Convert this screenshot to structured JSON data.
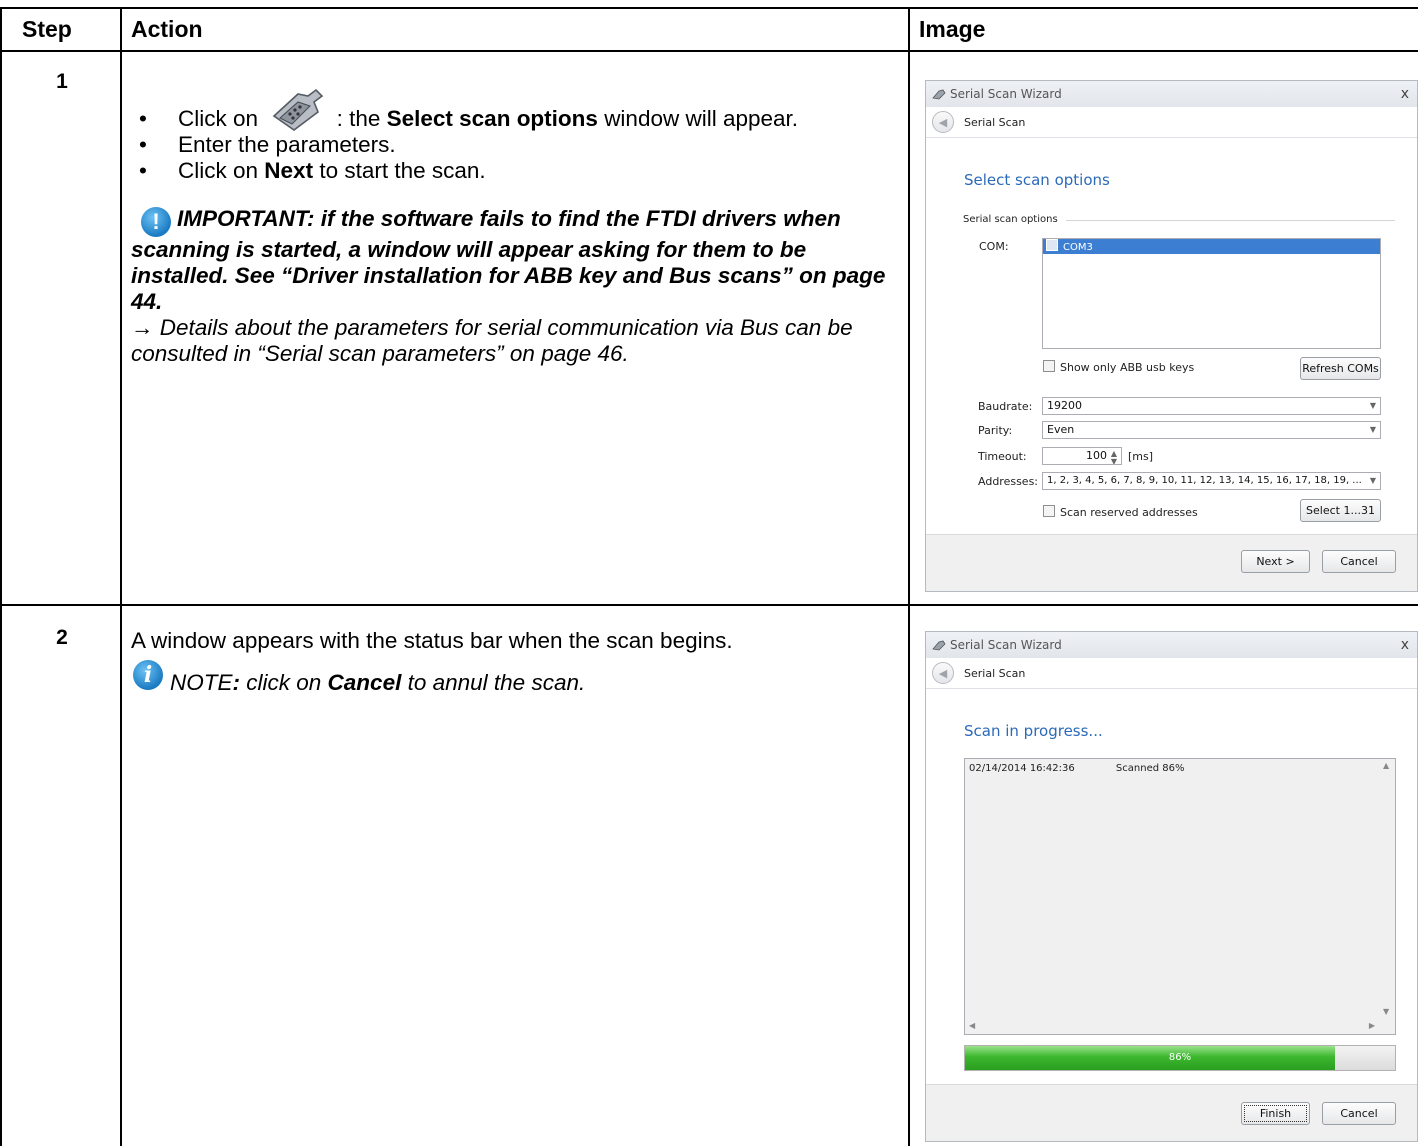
{
  "table": {
    "headers": {
      "step": "Step",
      "action": "Action",
      "image": "Image"
    },
    "rows": [
      {
        "step": "1",
        "bullets": {
          "b1_prefix": "Click on",
          "b1_bold": "Select scan options",
          "b1_suffix_pre": ": the",
          "b1_suffix_post": "window will appear.",
          "b2": "Enter the parameters.",
          "b3_prefix": "Click on",
          "b3_bold": "Next",
          "b3_suffix": "to start the scan."
        },
        "important": "IMPORTANT: if the software fails to find the FTDI drivers when scanning is started, a window will appear asking for them to be installed. See “Driver installation for ABB key and Bus scans” on page 44.",
        "details": "→ Details about the parameters for serial communication via Bus can be consulted in “Serial scan parameters” on page 46."
      },
      {
        "step": "2",
        "text": "A window appears with the status bar when the scan begins.",
        "note_prefix": "NOTE",
        "note_colon": ":",
        "note_mid": " click on ",
        "note_bold": "Cancel",
        "note_suffix": " to annul the scan."
      }
    ]
  },
  "dialog1": {
    "title": "Serial Scan Wizard",
    "close": "x",
    "nav_title": "Serial Scan",
    "heading": "Select scan options",
    "group_label": "Serial scan options",
    "com_label": "COM:",
    "com_items": [
      "COM3"
    ],
    "show_abb_only": "Show only ABB usb keys",
    "refresh_button": "Refresh COMs",
    "baudrate_label": "Baudrate:",
    "baudrate_value": "19200",
    "parity_label": "Parity:",
    "parity_value": "Even",
    "timeout_label": "Timeout:",
    "timeout_value": "100",
    "timeout_unit": "[ms]",
    "addresses_label": "Addresses:",
    "addresses_value": "1, 2, 3, 4, 5, 6, 7, 8, 9, 10, 11, 12, 13, 14, 15, 16, 17, 18, 19, ...",
    "scan_reserved": "Scan reserved addresses",
    "select_button": "Select 1...31",
    "next_button": "Next >",
    "cancel_button": "Cancel"
  },
  "dialog2": {
    "title": "Serial Scan Wizard",
    "close": "x",
    "nav_title": "Serial Scan",
    "heading": "Scan in progress...",
    "log_time": "02/14/2014 16:42:36",
    "log_msg": "Scanned 86%",
    "progress_label": "86%",
    "progress_fraction": 0.86,
    "finish_button": "Finish",
    "cancel_button": "Cancel"
  },
  "colors": {
    "progress_green": "#3cb72e",
    "heading_blue": "#2b6ab8",
    "info_blue": "#1a7bc2"
  },
  "icons": [
    "serial-plug-icon",
    "important-icon",
    "info-icon",
    "back-arrow-icon",
    "wizard-icon"
  ]
}
